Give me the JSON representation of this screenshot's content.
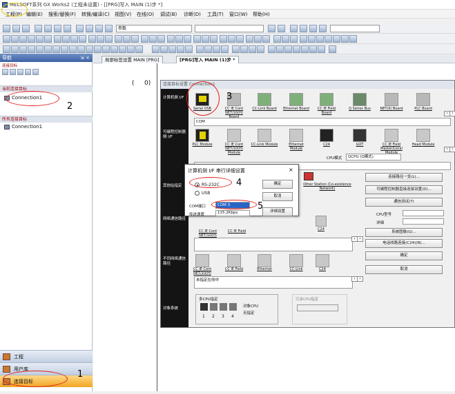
{
  "title": "MELSOFT系列 GX Works2 (工程未设置) - [[PRG]写入 MAIN (1)步 *]",
  "menu": [
    "工程(P)",
    "编辑(E)",
    "搜索/替换(F)",
    "转换/编译(C)",
    "视图(V)",
    "在线(O)",
    "调试(B)",
    "诊断(D)",
    "工具(T)",
    "窗口(W)",
    "帮助(H)"
  ],
  "toolbar": {
    "combo1": "参数",
    "combo2": ""
  },
  "nav": {
    "title": "导航",
    "pin": "⇲ ×",
    "sect_title": "连接目标",
    "current_section": "当前连接目标",
    "current_item": "Connection1",
    "all_section": "所有连接目标",
    "all_item": "Connection1",
    "buttons": [
      "工程",
      "用户库",
      "连接目标"
    ]
  },
  "tabs": [
    "局部标签设置 MAIN [PRG]",
    "[PRG]写入 MAIN (1)步 *"
  ],
  "editor": {
    "left_bracket": "(",
    "step": "0)"
  },
  "dialog": {
    "title": "连接目标设置 Connection1",
    "left_labels": [
      "计算机侧 I/F",
      "可编程控制器侧 I/F",
      "其他站指定",
      "网络通信路径",
      "不同网络通信路径",
      "对象系统"
    ],
    "pc_side": [
      {
        "cap": "Serial USB"
      },
      {
        "cap": "CC IE Cont NET/10(H) Board"
      },
      {
        "cap": "CC-Link Board"
      },
      {
        "cap": "Ethernet Board"
      },
      {
        "cap": "CC IE Field Board"
      },
      {
        "cap": "Q Series Bus"
      },
      {
        "cap": "NET(II) Board"
      },
      {
        "cap": "PLC Board"
      }
    ],
    "pc_field": "COM",
    "plc_side": [
      {
        "cap": "PLC Module"
      },
      {
        "cap": "CC IE Cont NET/10(H) Module"
      },
      {
        "cap": "CC-Link Module"
      },
      {
        "cap": "Ethernet Module"
      },
      {
        "cap": "C24"
      },
      {
        "cap": "GOT"
      },
      {
        "cap": "CC IE Field Master/Local Module"
      },
      {
        "cap": "Head Module"
      }
    ],
    "cpu_mode_label": "CPU模式",
    "cpu_mode_value": "QCPU (Q模式)",
    "other_station": "Other Station (Co-existence Network)",
    "right_buttons": [
      "连接路径一览(L)...",
      "可编程控制器直接连接设置(D)...",
      "通信测试(T)",
      "系统图像(G)...",
      "电话线路连接(C24)(N)..."
    ],
    "cpu_type_label": "CPU型号",
    "detail_label": "详细",
    "net_route_bottom": [
      "CC IE Cont NET/10(H)",
      "CC IE Field",
      "Ethernet",
      "CC-Link",
      "C24"
    ],
    "net_route_top": [
      "CC IE Cont NET/10(H)",
      "CC IE Field"
    ],
    "c24_label": "C24",
    "multi_cpu": "多CPU指定",
    "target_cpu": "对象CPU",
    "no_spec": "无指定",
    "cpu_nums": [
      "1",
      "2",
      "3",
      "4"
    ],
    "redundant": "冗余CPU指定",
    "comment": "未指定在线中",
    "ok": "确定",
    "cancel": "取消"
  },
  "popup": {
    "title": "计算机侧 I/F 串行详细设置",
    "close": "×",
    "rs232c": "RS-232C",
    "usb": "USB",
    "com_label": "COM端口",
    "com_value": "COM 3",
    "speed_label": "传送速度",
    "speed_value": "115.2Kbps",
    "ok": "确定",
    "cancel": "取消",
    "detail": "详细设置"
  },
  "annotations": [
    "1",
    "2",
    "3",
    "4",
    "5"
  ]
}
